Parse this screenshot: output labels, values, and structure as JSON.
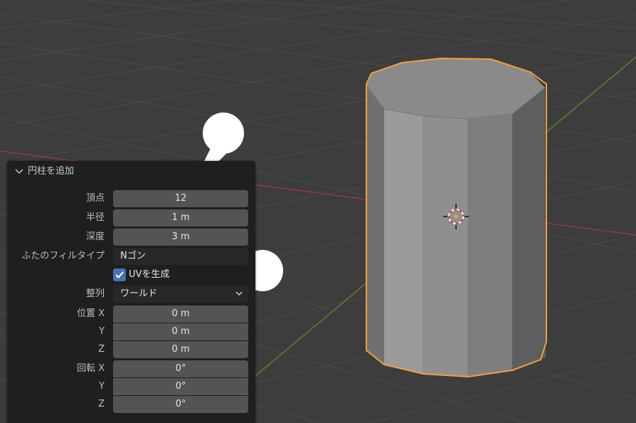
{
  "panel": {
    "title": "円柱を追加",
    "vertices": {
      "label": "頂点",
      "value": "12"
    },
    "radius": {
      "label": "半径",
      "value": "1 m"
    },
    "depth": {
      "label": "深度",
      "value": "3 m"
    },
    "cap_fill_type": {
      "label": "ふたのフィルタイプ",
      "value": "Nゴン"
    },
    "generate_uvs": {
      "label": "UVを生成",
      "checked": true
    },
    "align": {
      "label": "整列",
      "value": "ワールド"
    },
    "location": {
      "label_x": "位置 X",
      "label_y": "Y",
      "label_z": "Z",
      "x": "0 m",
      "y": "0 m",
      "z": "0 m"
    },
    "rotation": {
      "label_x": "回転 X",
      "label_y": "Y",
      "label_z": "Z",
      "x": "0°",
      "y": "0°",
      "z": "0°"
    }
  },
  "colors": {
    "viewport_bg": "#3d3d3d",
    "grid_line": "#4a4a4a",
    "x_axis": "#9a3c46",
    "y_axis": "#5f8a2c",
    "selection_outline": "#f0a040",
    "panel_bg": "#1f1f1f",
    "field_bg": "#545454",
    "checkbox_accent": "#4772b3"
  },
  "icons": {
    "panel_collapse": "chevron-down-icon",
    "dropdown": "chevron-down-icon",
    "origin": "3d-cursor-icon",
    "checkbox": "checkmark-icon"
  }
}
